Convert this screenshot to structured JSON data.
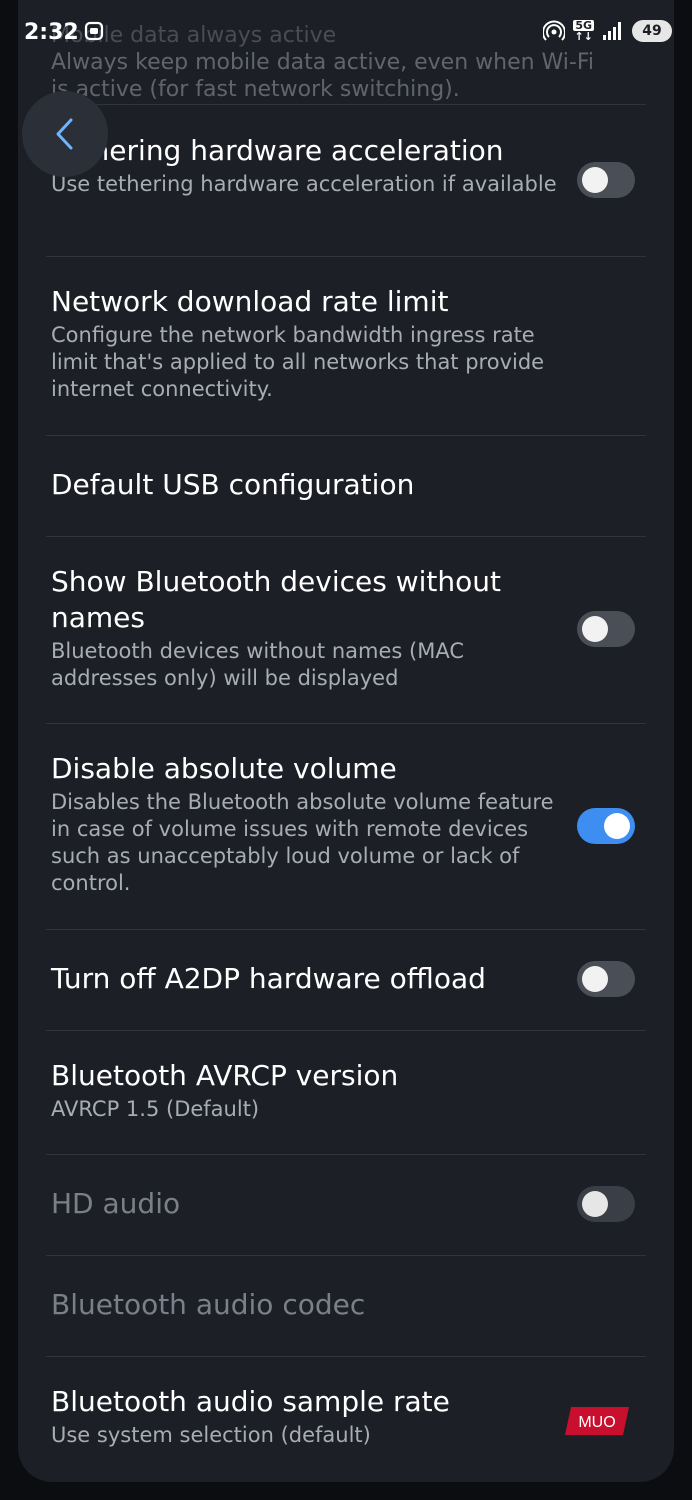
{
  "status_bar": {
    "time": "2:32",
    "network_type": "5G",
    "battery": "49"
  },
  "top_partial": {
    "title": "Mobile data always active",
    "summary": "Always keep mobile data active, even when Wi-Fi is active (for fast network switching)."
  },
  "settings": [
    {
      "title": "Tethering hardware acceleration",
      "summary": "Use tethering hardware acceleration if available",
      "toggle": "off"
    },
    {
      "title": "Network download rate limit",
      "summary": "Configure the network bandwidth ingress rate limit that's applied to all networks that provide internet connectivity."
    },
    {
      "title": "Default USB configuration"
    },
    {
      "title": "Show Bluetooth devices without names",
      "summary": "Bluetooth devices without names (MAC addresses only) will be displayed",
      "toggle": "off"
    },
    {
      "title": "Disable absolute volume",
      "summary": "Disables the Bluetooth absolute volume feature in case of volume issues with remote devices such as unacceptably loud volume or lack of control.",
      "toggle": "on"
    },
    {
      "title": "Turn off A2DP hardware offload",
      "toggle": "off"
    },
    {
      "title": "Bluetooth AVRCP version",
      "summary": "AVRCP 1.5 (Default)"
    },
    {
      "title": "HD audio",
      "toggle": "off",
      "disabled": true
    },
    {
      "title": "Bluetooth audio codec",
      "disabled": true
    },
    {
      "title": "Bluetooth audio sample rate",
      "summary": "Use system selection (default)"
    }
  ],
  "watermark": "MUO",
  "colors": {
    "panel": "#1c1f26",
    "toggle_on": "#3d8ef0",
    "toggle_off": "#4a4e57",
    "watermark_red": "#c8102e"
  },
  "icons": [
    "screen-record-icon",
    "hotspot-icon",
    "signal-icon",
    "back-arrow-icon"
  ]
}
